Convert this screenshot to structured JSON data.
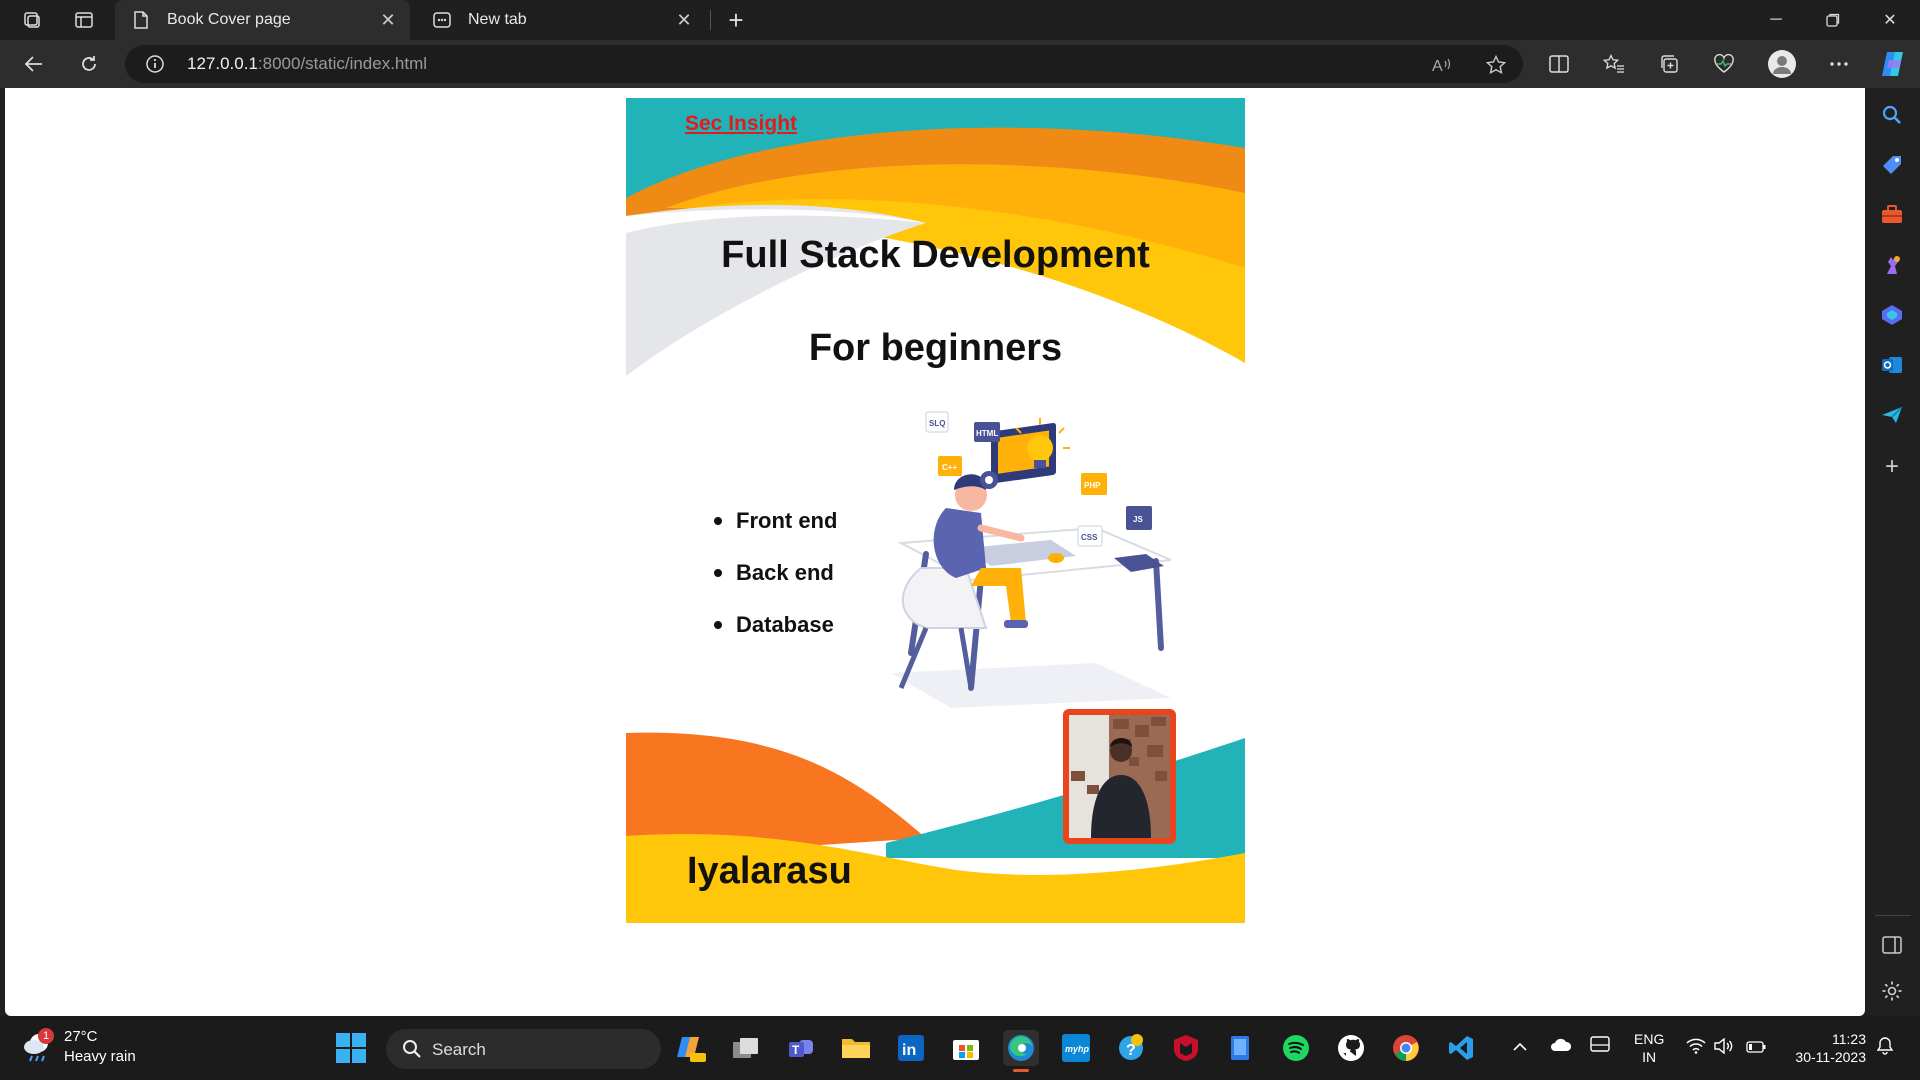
{
  "browser": {
    "tabs": [
      {
        "title": "Book Cover page",
        "active": true
      },
      {
        "title": "New tab",
        "active": false
      }
    ],
    "address": {
      "host": "127.0.0.1",
      "rest": ":8000/static/index.html"
    }
  },
  "cover": {
    "brand": "Sec Insight",
    "title_line1": "Full Stack Development",
    "title_line2": "For beginners",
    "topics": [
      "Front end",
      "Back end",
      "Database"
    ],
    "author": "Iyalarasu",
    "illustration_tags": [
      "SLQ",
      "HTML",
      "C++",
      "PHP",
      "CSS",
      "JS"
    ],
    "colors": {
      "teal": "#21b3b8",
      "yellow": "#ffc60a",
      "orange": "#f7761f",
      "gray": "#e4e6e9"
    }
  },
  "taskbar": {
    "weather": {
      "temp": "27°C",
      "desc": "Heavy rain",
      "badge": "1"
    },
    "search_label": "Search",
    "lang": {
      "line1": "ENG",
      "line2": "IN"
    },
    "clock": {
      "time": "11:23",
      "date": "30-11-2023"
    }
  }
}
